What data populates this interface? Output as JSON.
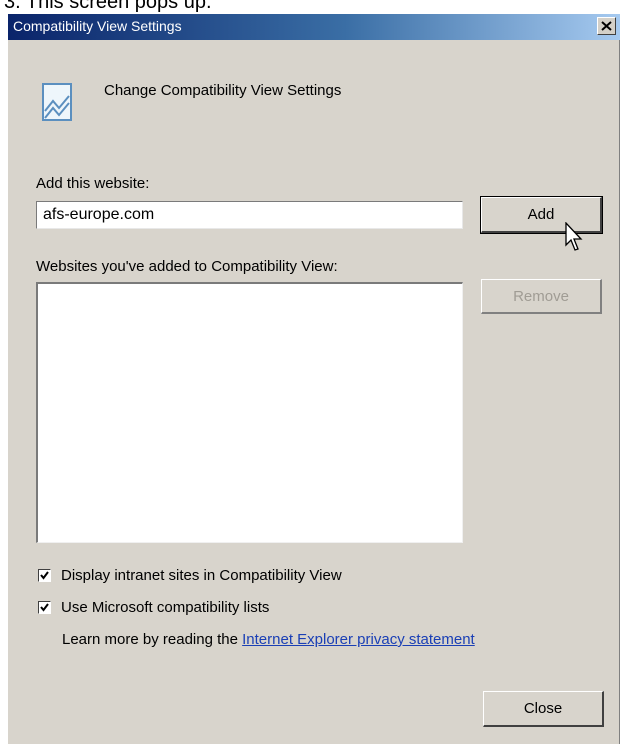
{
  "caption": "3. This screen pops up.",
  "dialog": {
    "title": "Compatibility View Settings",
    "header": "Change Compatibility View Settings",
    "add_label": "Add this website:",
    "website_input_value": "afs-europe.com",
    "add_button": "Add",
    "list_label": "Websites you've added to Compatibility View:",
    "websites": [],
    "remove_button": "Remove",
    "checkboxes": [
      {
        "label": "Display intranet sites in Compatibility View",
        "checked": true
      },
      {
        "label": "Use Microsoft compatibility lists",
        "checked": true
      }
    ],
    "learn_more_prefix": "Learn more by reading the ",
    "learn_more_link": "Internet Explorer privacy statement",
    "close_button": "Close"
  },
  "icons": [
    "close-icon",
    "compatibility-view-icon",
    "checkmark-icon",
    "mouse-pointer-icon"
  ],
  "colors": {
    "titlebar_start": "#0a246a",
    "titlebar_end": "#a6caf0",
    "dialog_bg": "#d8d4cc",
    "link": "#1a3fb5"
  }
}
